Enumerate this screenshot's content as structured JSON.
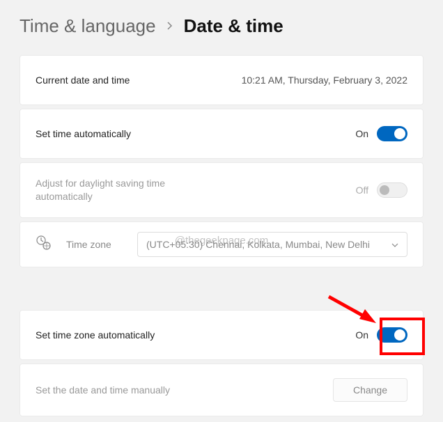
{
  "breadcrumb": {
    "parent": "Time & language",
    "current": "Date & time"
  },
  "currentTime": {
    "label": "Current date and time",
    "value": "10:21 AM, Thursday, February 3, 2022"
  },
  "setTimeAuto": {
    "label": "Set time automatically",
    "state": "On"
  },
  "adjustDst": {
    "label": "Adjust for daylight saving time automatically",
    "state": "Off"
  },
  "timezone": {
    "label": "Time zone",
    "value": "(UTC+05:30) Chennai, Kolkata, Mumbai, New Delhi"
  },
  "setTzAuto": {
    "label": "Set time zone automatically",
    "state": "On"
  },
  "setManually": {
    "label": "Set the date and time manually",
    "button": "Change"
  },
  "watermark": "@thegeekpage.com"
}
